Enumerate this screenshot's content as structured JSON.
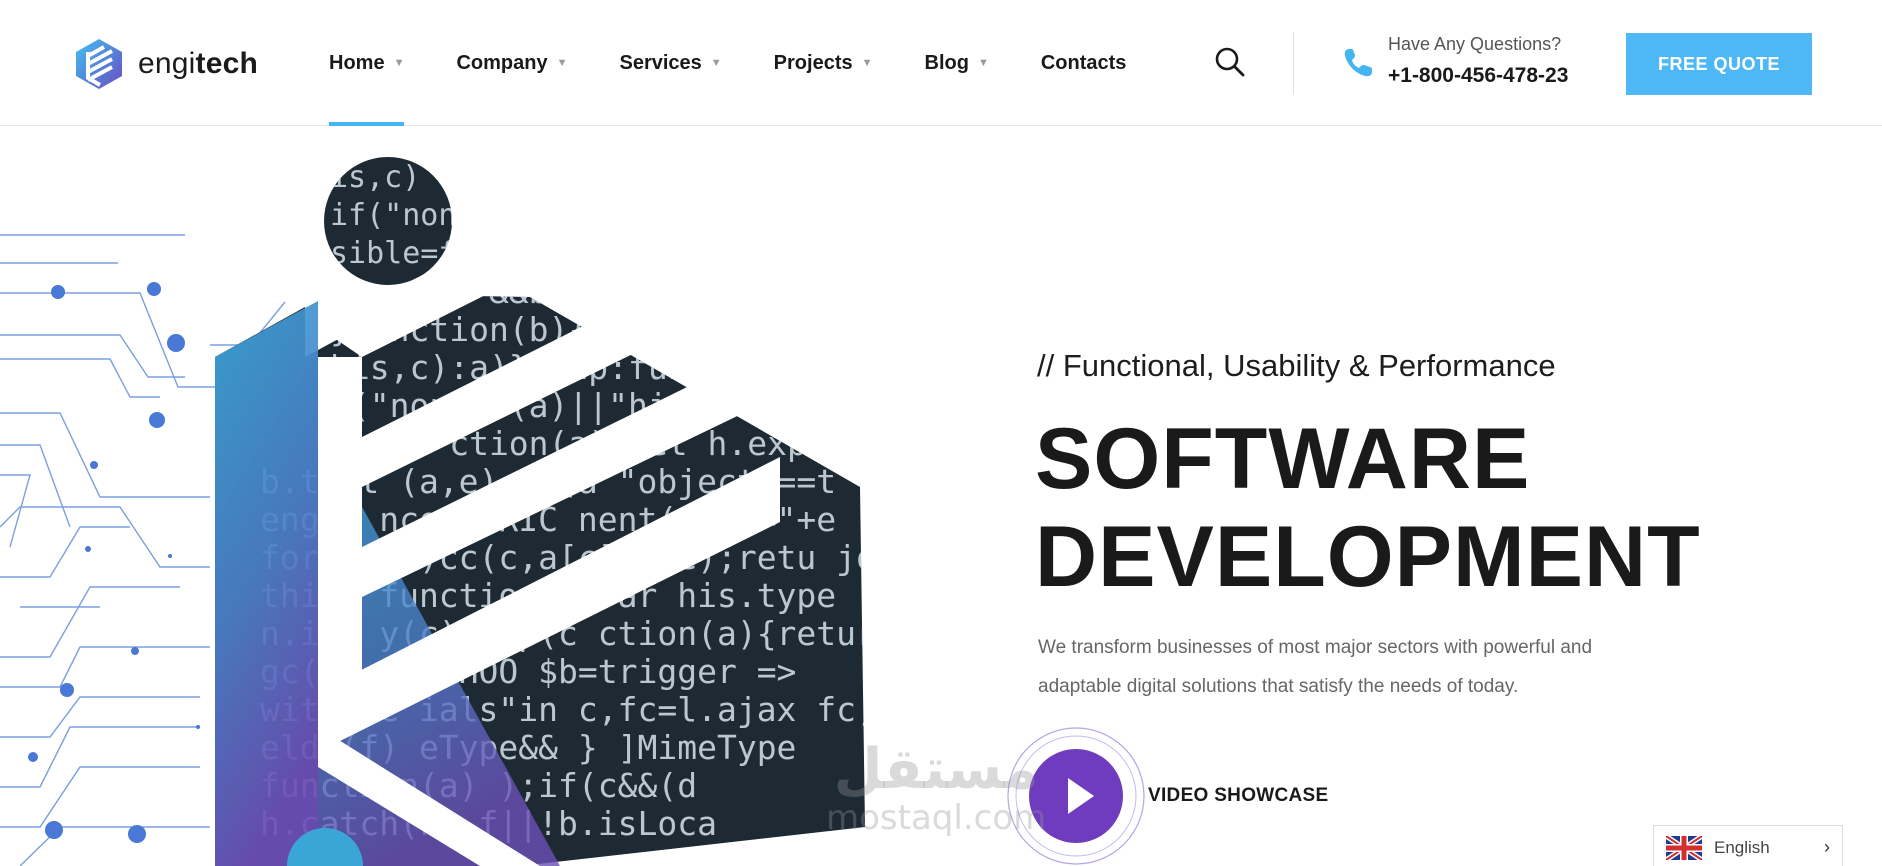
{
  "brand": {
    "name_light": "engi",
    "name_bold": "tech"
  },
  "nav": {
    "items": [
      {
        "label": "Home",
        "has_dropdown": true
      },
      {
        "label": "Company",
        "has_dropdown": true
      },
      {
        "label": "Services",
        "has_dropdown": true
      },
      {
        "label": "Projects",
        "has_dropdown": true
      },
      {
        "label": "Blog",
        "has_dropdown": true
      },
      {
        "label": "Contacts",
        "has_dropdown": false
      }
    ],
    "active": "Home",
    "caret": "▼"
  },
  "contact": {
    "question": "Have Any Questions?",
    "phone": "+1-800-456-478-23"
  },
  "cta": {
    "label": "FREE QUOTE"
  },
  "hero": {
    "tagline": "// Functional, Usability & Performance",
    "headline_line1": "SOFTWARE",
    "headline_line2": "DEVELOPMENT",
    "description_line1": "We transform businesses of most major sectors with powerful and",
    "description_line2": "adaptable digital solutions that satisfy the needs of today.",
    "video_label": "VIDEO SHOWCASE"
  },
  "watermark": {
    "arabic": "مستقل",
    "latin": "mostaql.com"
  },
  "language": {
    "label": "English",
    "chevron": "›"
  },
  "colors": {
    "accent": "#44b5f3",
    "cta_bg": "#4db8f5",
    "play": "#6f3bbf",
    "circuit": "#5b8ad6",
    "code_bg": "#1d2a33"
  },
  "code_snippets": [
    "is,c)",
    "if(\"none",
    "sible=f   &&b.inse",
    "}function(b){n",
    "his,c):a)}}   ap:func",
    "f(\"none\"   (a)||\"hidd",
    "ble=f   ction(a){ret   h.expr",
    "b.test   (a,e):cc(a   \"object\"==t",
    "ength   ncodeURIC   nent(a)+\"=\"+e",
    "for(   c(a)cc(c,a[c],b,e);retu   join",
    "this.   function(){var   his.type",
    "n.isA   y(c)   map(c   ction(a){return",
    "gc():   (HE HOO   $b=trigger   =>",
    "withCre   ials\"in   c,fc=l.ajax   fc,fc",
    "elds(f)   eType&&   }   ]MimeType",
    "function(a)   );if(c&&(d",
    "h.catch(k)   f||!b.isLoca"
  ]
}
